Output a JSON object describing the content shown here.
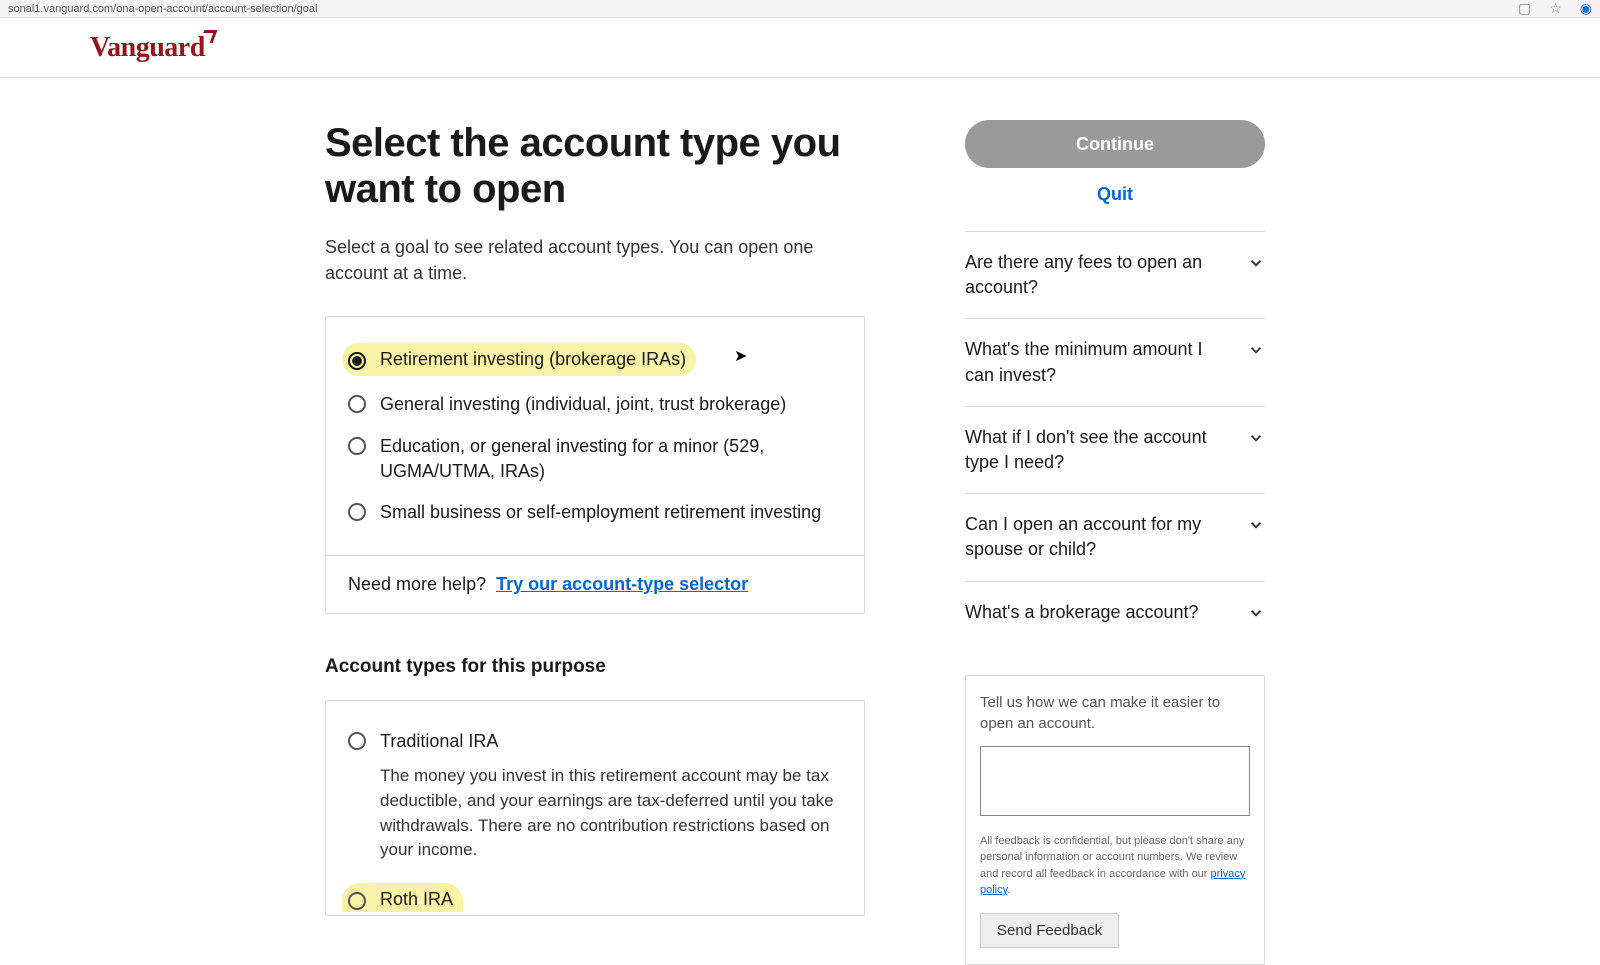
{
  "browser": {
    "url": "sonal1.vanguard.com/ona-open-account/account-selection/goal"
  },
  "logo": "Vanguard",
  "page": {
    "title": "Select the account type you want to open",
    "subtitle": "Select a goal to see related account types. You can open one account at a time."
  },
  "goals": [
    {
      "label": "Retirement investing (brokerage IRAs)",
      "selected": true
    },
    {
      "label": "General investing (individual, joint, trust brokerage)",
      "selected": false
    },
    {
      "label": "Education, or general investing for a minor (529, UGMA/UTMA, IRAs)",
      "selected": false
    },
    {
      "label": "Small business or self-employment retirement investing",
      "selected": false
    }
  ],
  "help": {
    "prefix": "Need more help?",
    "link_text": "Try our account-type selector"
  },
  "account_types_heading": "Account types for this purpose",
  "account_types": [
    {
      "label": "Traditional IRA",
      "selected": false,
      "desc": "The money you invest in this retirement account may be tax deductible, and your earnings are tax-deferred until you take withdrawals. There are no contribution restrictions based on your income."
    },
    {
      "label": "Roth IRA",
      "selected": false,
      "desc": ""
    }
  ],
  "sidebar": {
    "continue_label": "Continue",
    "quit_label": "Quit",
    "faq": [
      "Are there any fees to open an account?",
      "What's the minimum amount I can invest?",
      "What if I don't see the account type I need?",
      "Can I open an account for my spouse or child?",
      "What's a brokerage account?"
    ],
    "feedback": {
      "prompt": "Tell us how we can make it easier to open an account.",
      "disclaimer_pre": "All feedback is confidential, but please don't share any personal information or account numbers. We review and record all feedback in accordance with our ",
      "disclaimer_link": "privacy policy",
      "disclaimer_post": ".",
      "send_label": "Send Feedback"
    }
  }
}
